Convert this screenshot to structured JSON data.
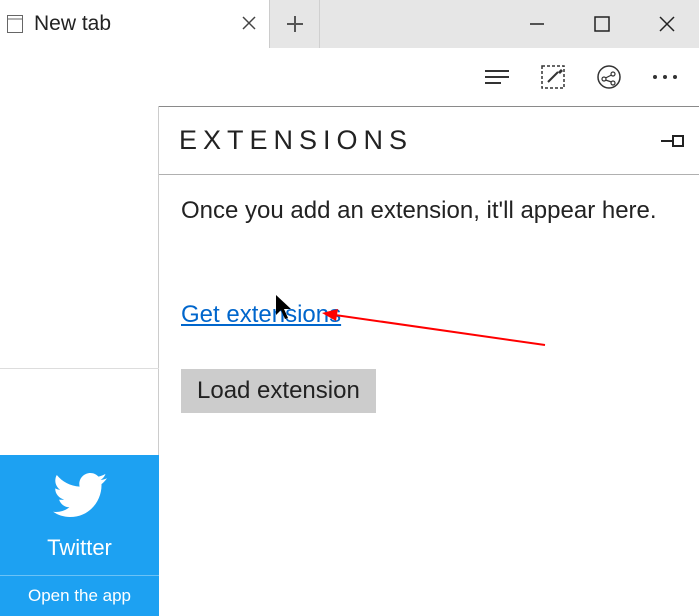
{
  "tab": {
    "title": "New tab"
  },
  "toolbar": {},
  "extensions": {
    "heading": "EXTENSIONS",
    "desc": "Once you add an extension, it'll appear here.",
    "get_link": "Get extensions",
    "load_button": "Load extension"
  },
  "start_tile": {
    "name": "Twitter",
    "cta": "Open the app"
  }
}
